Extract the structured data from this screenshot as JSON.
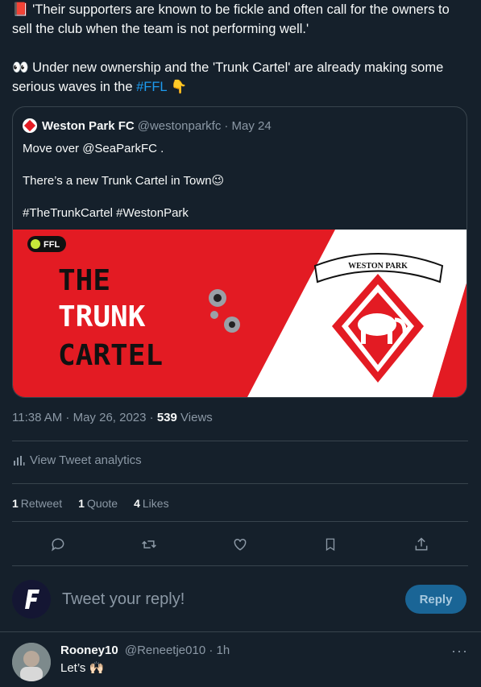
{
  "tweet": {
    "line1_emoji": "📕",
    "line1": "'Their supporters are known to be fickle and often call for the owners to sell the club when the team is not performing well.'",
    "line2_emoji": "👀",
    "line2": "Under new ownership and the 'Trunk Cartel' are already making some serious waves in the",
    "hashtag": "#FFL",
    "line2_end_emoji": "👇"
  },
  "quote": {
    "name": "Weston Park FC",
    "handle": "@westonparkfc",
    "date": "· May 24",
    "line1": "Move over @SeaParkFC .",
    "line2": "There’s a new Trunk Cartel in Town😉",
    "line3": "#TheTrunkCartel #WestonPark",
    "media": {
      "ffl_badge": "FFL",
      "title_line1": "THE",
      "title_line2": "TRUNK",
      "title_line3": "CARTEL",
      "crest_text": "WESTON PARK",
      "colors": {
        "red": "#e31b23",
        "white": "#ffffff",
        "black": "#111111"
      }
    }
  },
  "meta": {
    "time": "11:38 AM · May 26, 2023 ·",
    "views_count": "539",
    "views_label": "Views"
  },
  "analytics": {
    "icon": "analytics-bars-icon",
    "label": "View Tweet analytics"
  },
  "stats": {
    "retweets_count": "1",
    "retweets_label": "Retweet",
    "quotes_count": "1",
    "quotes_label": "Quote",
    "likes_count": "4",
    "likes_label": "Likes"
  },
  "actions": [
    "reply-icon",
    "retweet-icon",
    "like-icon",
    "bookmark-icon",
    "share-icon"
  ],
  "reply_box": {
    "placeholder": "Tweet your reply!",
    "button": "Reply"
  },
  "comment": {
    "name": "Rooney10",
    "handle": "@Reneetje010",
    "time": "· 1h",
    "text": "Let’s 🙌🏻",
    "more": "···"
  },
  "colors": {
    "background": "#15202b",
    "accent": "#1d9bf0",
    "muted": "#8b98a5",
    "border": "#38444d"
  }
}
